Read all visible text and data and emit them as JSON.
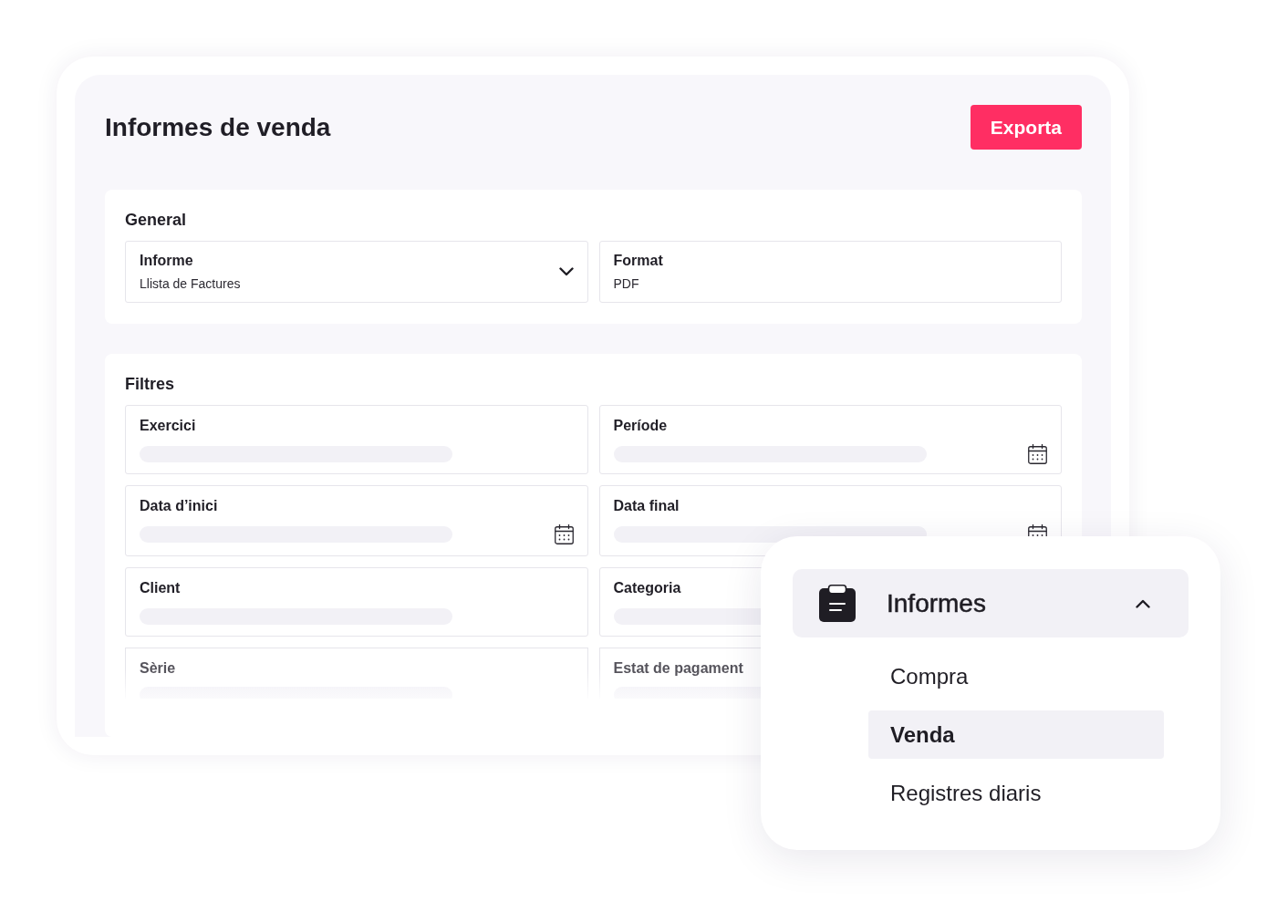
{
  "report_page": {
    "title": "Informes de venda",
    "export_button": "Exporta",
    "general": {
      "heading": "General",
      "fields": [
        {
          "label": "Informe",
          "value": "Llista de Factures",
          "kind": "select"
        },
        {
          "label": "Format",
          "value": "PDF",
          "kind": "text"
        }
      ]
    },
    "filters": {
      "heading": "Filtres",
      "fields": [
        {
          "label": "Exercici",
          "kind": "plain"
        },
        {
          "label": "Període",
          "kind": "date"
        },
        {
          "label": "Data d’inici",
          "kind": "date"
        },
        {
          "label": "Data final",
          "kind": "date"
        },
        {
          "label": "Client",
          "kind": "plain"
        },
        {
          "label": "Categoria",
          "kind": "plain"
        },
        {
          "label": "Sèrie",
          "kind": "plain"
        },
        {
          "label": "Estat de pagament",
          "kind": "plain"
        }
      ]
    }
  },
  "menu": {
    "title": "Informes",
    "expanded": true,
    "items": [
      {
        "label": "Compra",
        "selected": false
      },
      {
        "label": "Venda",
        "selected": true
      },
      {
        "label": "Registres diaris",
        "selected": false
      }
    ]
  }
}
